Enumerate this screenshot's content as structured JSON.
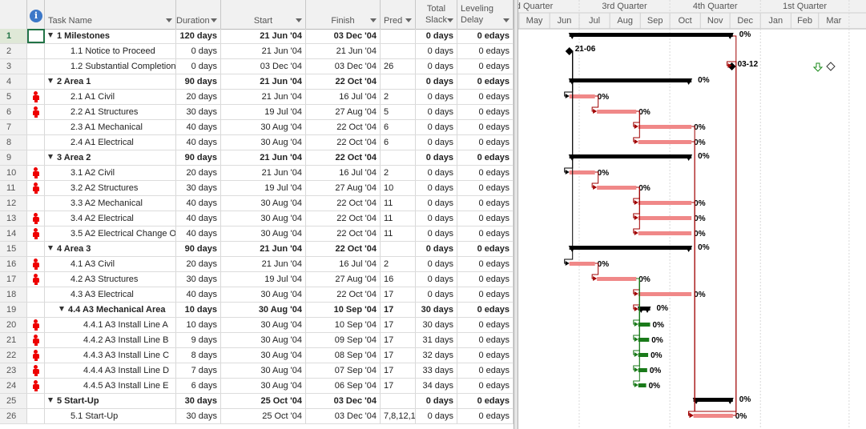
{
  "columns": {
    "task_name": "Task Name",
    "duration": "Duration",
    "start": "Start",
    "finish": "Finish",
    "pred": "Pred",
    "total_slack_1": "Total",
    "total_slack_2": "Slack",
    "leveling_1": "Leveling",
    "leveling_2": "Delay"
  },
  "timescale": {
    "quarters": [
      "d Quarter",
      "3rd Quarter",
      "4th Quarter",
      "1st Quarter"
    ],
    "months": [
      "May",
      "Jun",
      "Jul",
      "Aug",
      "Sep",
      "Oct",
      "Nov",
      "Dec",
      "Jan",
      "Feb",
      "Mar"
    ]
  },
  "selected_row": 1,
  "colors": {
    "summary_bar": "#000000",
    "critical_bar": "#f08888",
    "noncritical_bar": "#1a7a1a",
    "link_critical": "#a00000",
    "resource_icon": "#e00000"
  },
  "tasks": [
    {
      "id": "1",
      "name": "1 Milestones",
      "duration": "120 days",
      "start": "21 Jun '04",
      "finish": "03 Dec '04",
      "pred": "",
      "slack": "0 days",
      "delay": "0 edays",
      "summary": true,
      "level": 0,
      "icon": false,
      "bar_start": "2004-06-21",
      "bar_end": "2004-12-03",
      "type": "summary",
      "label": "0%"
    },
    {
      "id": "2",
      "name": "1.1 Notice to Proceed",
      "duration": "0 days",
      "start": "21 Jun '04",
      "finish": "21 Jun '04",
      "pred": "",
      "slack": "0 days",
      "delay": "0 edays",
      "summary": false,
      "level": 1,
      "icon": false,
      "bar_start": "2004-06-21",
      "bar_end": "2004-06-21",
      "type": "milestone",
      "label": "21-06"
    },
    {
      "id": "3",
      "name": "1.2 Substantial Completion",
      "duration": "0 days",
      "start": "03 Dec '04",
      "finish": "03 Dec '04",
      "pred": "26",
      "slack": "0 days",
      "delay": "0 edays",
      "summary": false,
      "level": 1,
      "icon": false,
      "bar_start": "2004-12-03",
      "bar_end": "2004-12-03",
      "type": "milestone",
      "label": "03-12"
    },
    {
      "id": "4",
      "name": "2 Area 1",
      "duration": "90 days",
      "start": "21 Jun '04",
      "finish": "22 Oct '04",
      "pred": "",
      "slack": "0 days",
      "delay": "0 edays",
      "summary": true,
      "level": 0,
      "icon": false,
      "bar_start": "2004-06-21",
      "bar_end": "2004-10-22",
      "type": "summary",
      "label": "0%"
    },
    {
      "id": "5",
      "name": "2.1 A1 Civil",
      "duration": "20 days",
      "start": "21 Jun '04",
      "finish": "16 Jul '04",
      "pred": "2",
      "slack": "0 days",
      "delay": "0 edays",
      "summary": false,
      "level": 1,
      "icon": true,
      "bar_start": "2004-06-21",
      "bar_end": "2004-07-16",
      "type": "critical",
      "label": "0%"
    },
    {
      "id": "6",
      "name": "2.2 A1 Structures",
      "duration": "30 days",
      "start": "19 Jul '04",
      "finish": "27 Aug '04",
      "pred": "5",
      "slack": "0 days",
      "delay": "0 edays",
      "summary": false,
      "level": 1,
      "icon": true,
      "bar_start": "2004-07-19",
      "bar_end": "2004-08-27",
      "type": "critical",
      "label": "0%"
    },
    {
      "id": "7",
      "name": "2.3 A1 Mechanical",
      "duration": "40 days",
      "start": "30 Aug '04",
      "finish": "22 Oct '04",
      "pred": "6",
      "slack": "0 days",
      "delay": "0 edays",
      "summary": false,
      "level": 1,
      "icon": false,
      "bar_start": "2004-08-30",
      "bar_end": "2004-10-22",
      "type": "critical",
      "label": "0%"
    },
    {
      "id": "8",
      "name": "2.4 A1 Electrical",
      "duration": "40 days",
      "start": "30 Aug '04",
      "finish": "22 Oct '04",
      "pred": "6",
      "slack": "0 days",
      "delay": "0 edays",
      "summary": false,
      "level": 1,
      "icon": false,
      "bar_start": "2004-08-30",
      "bar_end": "2004-10-22",
      "type": "critical",
      "label": "0%"
    },
    {
      "id": "9",
      "name": "3 Area 2",
      "duration": "90 days",
      "start": "21 Jun '04",
      "finish": "22 Oct '04",
      "pred": "",
      "slack": "0 days",
      "delay": "0 edays",
      "summary": true,
      "level": 0,
      "icon": false,
      "bar_start": "2004-06-21",
      "bar_end": "2004-10-22",
      "type": "summary",
      "label": "0%"
    },
    {
      "id": "10",
      "name": "3.1 A2 Civil",
      "duration": "20 days",
      "start": "21 Jun '04",
      "finish": "16 Jul '04",
      "pred": "2",
      "slack": "0 days",
      "delay": "0 edays",
      "summary": false,
      "level": 1,
      "icon": true,
      "bar_start": "2004-06-21",
      "bar_end": "2004-07-16",
      "type": "critical",
      "label": "0%"
    },
    {
      "id": "11",
      "name": "3.2 A2 Structures",
      "duration": "30 days",
      "start": "19 Jul '04",
      "finish": "27 Aug '04",
      "pred": "10",
      "slack": "0 days",
      "delay": "0 edays",
      "summary": false,
      "level": 1,
      "icon": true,
      "bar_start": "2004-07-19",
      "bar_end": "2004-08-27",
      "type": "critical",
      "label": "0%"
    },
    {
      "id": "12",
      "name": "3.3 A2 Mechanical",
      "duration": "40 days",
      "start": "30 Aug '04",
      "finish": "22 Oct '04",
      "pred": "11",
      "slack": "0 days",
      "delay": "0 edays",
      "summary": false,
      "level": 1,
      "icon": false,
      "bar_start": "2004-08-30",
      "bar_end": "2004-10-22",
      "type": "critical",
      "label": "0%"
    },
    {
      "id": "13",
      "name": "3.4 A2 Electrical",
      "duration": "40 days",
      "start": "30 Aug '04",
      "finish": "22 Oct '04",
      "pred": "11",
      "slack": "0 days",
      "delay": "0 edays",
      "summary": false,
      "level": 1,
      "icon": true,
      "bar_start": "2004-08-30",
      "bar_end": "2004-10-22",
      "type": "critical",
      "label": "0%"
    },
    {
      "id": "14",
      "name": "3.5 A2 Electrical Change O",
      "duration": "40 days",
      "start": "30 Aug '04",
      "finish": "22 Oct '04",
      "pred": "11",
      "slack": "0 days",
      "delay": "0 edays",
      "summary": false,
      "level": 1,
      "icon": true,
      "bar_start": "2004-08-30",
      "bar_end": "2004-10-22",
      "type": "critical",
      "label": "0%"
    },
    {
      "id": "15",
      "name": "4 Area 3",
      "duration": "90 days",
      "start": "21 Jun '04",
      "finish": "22 Oct '04",
      "pred": "",
      "slack": "0 days",
      "delay": "0 edays",
      "summary": true,
      "level": 0,
      "icon": false,
      "bar_start": "2004-06-21",
      "bar_end": "2004-10-22",
      "type": "summary",
      "label": "0%"
    },
    {
      "id": "16",
      "name": "4.1 A3 Civil",
      "duration": "20 days",
      "start": "21 Jun '04",
      "finish": "16 Jul '04",
      "pred": "2",
      "slack": "0 days",
      "delay": "0 edays",
      "summary": false,
      "level": 1,
      "icon": true,
      "bar_start": "2004-06-21",
      "bar_end": "2004-07-16",
      "type": "critical",
      "label": "0%"
    },
    {
      "id": "17",
      "name": "4.2 A3 Structures",
      "duration": "30 days",
      "start": "19 Jul '04",
      "finish": "27 Aug '04",
      "pred": "16",
      "slack": "0 days",
      "delay": "0 edays",
      "summary": false,
      "level": 1,
      "icon": true,
      "bar_start": "2004-07-19",
      "bar_end": "2004-08-27",
      "type": "critical",
      "label": "0%"
    },
    {
      "id": "18",
      "name": "4.3 A3 Electrical",
      "duration": "40 days",
      "start": "30 Aug '04",
      "finish": "22 Oct '04",
      "pred": "17",
      "slack": "0 days",
      "delay": "0 edays",
      "summary": false,
      "level": 1,
      "icon": false,
      "bar_start": "2004-08-30",
      "bar_end": "2004-10-22",
      "type": "critical",
      "label": "0%"
    },
    {
      "id": "19",
      "name": "4.4 A3 Mechanical Area",
      "duration": "10 days",
      "start": "30 Aug '04",
      "finish": "10 Sep '04",
      "pred": "17",
      "slack": "30 days",
      "delay": "0 edays",
      "summary": true,
      "level": 1,
      "icon": false,
      "bar_start": "2004-08-30",
      "bar_end": "2004-09-10",
      "type": "summary",
      "label": "0%"
    },
    {
      "id": "20",
      "name": "4.4.1 A3 Install Line A",
      "duration": "10 days",
      "start": "30 Aug '04",
      "finish": "10 Sep '04",
      "pred": "17",
      "slack": "30 days",
      "delay": "0 edays",
      "summary": false,
      "level": 2,
      "icon": true,
      "bar_start": "2004-08-30",
      "bar_end": "2004-09-10",
      "type": "noncritical",
      "label": "0%"
    },
    {
      "id": "21",
      "name": "4.4.2 A3 Install Line B",
      "duration": "9 days",
      "start": "30 Aug '04",
      "finish": "09 Sep '04",
      "pred": "17",
      "slack": "31 days",
      "delay": "0 edays",
      "summary": false,
      "level": 2,
      "icon": true,
      "bar_start": "2004-08-30",
      "bar_end": "2004-09-09",
      "type": "noncritical",
      "label": "0%"
    },
    {
      "id": "22",
      "name": "4.4.3 A3 Install Line C",
      "duration": "8 days",
      "start": "30 Aug '04",
      "finish": "08 Sep '04",
      "pred": "17",
      "slack": "32 days",
      "delay": "0 edays",
      "summary": false,
      "level": 2,
      "icon": true,
      "bar_start": "2004-08-30",
      "bar_end": "2004-09-08",
      "type": "noncritical",
      "label": "0%"
    },
    {
      "id": "23",
      "name": "4.4.4 A3 Install Line D",
      "duration": "7 days",
      "start": "30 Aug '04",
      "finish": "07 Sep '04",
      "pred": "17",
      "slack": "33 days",
      "delay": "0 edays",
      "summary": false,
      "level": 2,
      "icon": true,
      "bar_start": "2004-08-30",
      "bar_end": "2004-09-07",
      "type": "noncritical",
      "label": "0%"
    },
    {
      "id": "24",
      "name": "4.4.5 A3 Install Line E",
      "duration": "6 days",
      "start": "30 Aug '04",
      "finish": "06 Sep '04",
      "pred": "17",
      "slack": "34 days",
      "delay": "0 edays",
      "summary": false,
      "level": 2,
      "icon": true,
      "bar_start": "2004-08-30",
      "bar_end": "2004-09-06",
      "type": "noncritical",
      "label": "0%"
    },
    {
      "id": "25",
      "name": "5 Start-Up",
      "duration": "30 days",
      "start": "25 Oct '04",
      "finish": "03 Dec '04",
      "pred": "",
      "slack": "0 days",
      "delay": "0 edays",
      "summary": true,
      "level": 0,
      "icon": false,
      "bar_start": "2004-10-25",
      "bar_end": "2004-12-03",
      "type": "summary",
      "label": "0%"
    },
    {
      "id": "26",
      "name": "5.1 Start-Up",
      "duration": "30 days",
      "start": "25 Oct '04",
      "finish": "03 Dec '04",
      "pred": "7,8,12,1",
      "slack": "0 days",
      "delay": "0 edays",
      "summary": false,
      "level": 1,
      "icon": false,
      "bar_start": "2004-10-25",
      "bar_end": "2004-12-03",
      "type": "critical",
      "label": "0%"
    }
  ]
}
